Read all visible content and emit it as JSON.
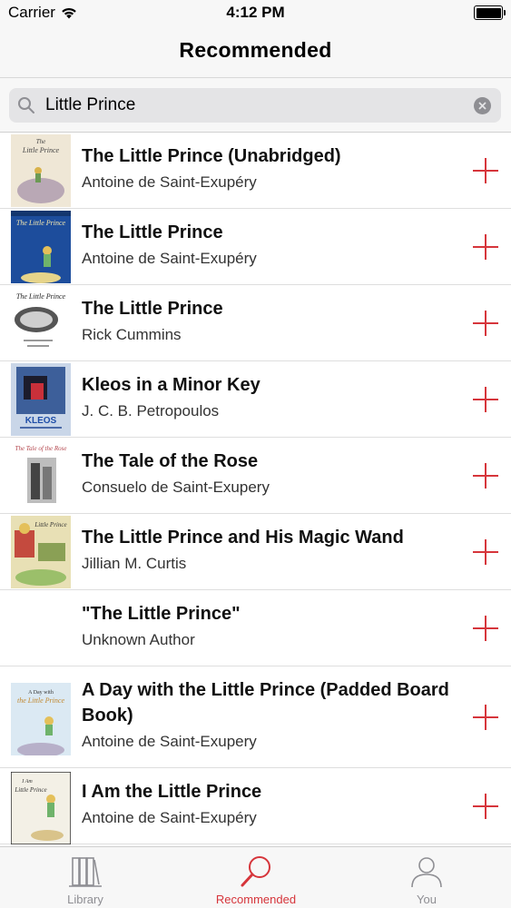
{
  "status_bar": {
    "carrier": "Carrier",
    "time": "4:12 PM"
  },
  "nav": {
    "title": "Recommended"
  },
  "search": {
    "value": "Little Prince",
    "placeholder": ""
  },
  "results": [
    {
      "title": "The Little Prince (Unabridged)",
      "author": "Antoine de Saint-Exupéry",
      "cover": "the-little-prince-unabridged-cover"
    },
    {
      "title": "The Little Prince",
      "author": "Antoine de Saint-Exupéry",
      "cover": "the-little-prince-cover"
    },
    {
      "title": "The Little Prince",
      "author": "Rick Cummins",
      "cover": "the-little-prince-cummins-cover"
    },
    {
      "title": "Kleos in a Minor Key",
      "author": "J. C. B. Petropoulos",
      "cover": "kleos-cover"
    },
    {
      "title": "The Tale of the Rose",
      "author": "Consuelo de Saint-Exupery",
      "cover": "tale-of-the-rose-cover"
    },
    {
      "title": "The Little Prince and His Magic Wand",
      "author": "Jillian M. Curtis",
      "cover": "magic-wand-cover"
    },
    {
      "title": "\"The Little Prince\"",
      "author": "Unknown Author",
      "cover": ""
    },
    {
      "title": "A Day with the Little Prince (Padded Board Book)",
      "author": "Antoine de Saint-Exupery",
      "cover": "a-day-with-cover"
    },
    {
      "title": "I Am the Little Prince",
      "author": "Antoine de Saint-Exupéry",
      "cover": "i-am-the-little-prince-cover"
    }
  ],
  "tabs": [
    {
      "label": "Library",
      "icon": "books-icon",
      "active": false
    },
    {
      "label": "Recommended",
      "icon": "magnifier-icon",
      "active": true
    },
    {
      "label": "You",
      "icon": "person-icon",
      "active": false
    }
  ],
  "colors": {
    "accent": "#d6353b",
    "inactive": "#8e8e93"
  }
}
